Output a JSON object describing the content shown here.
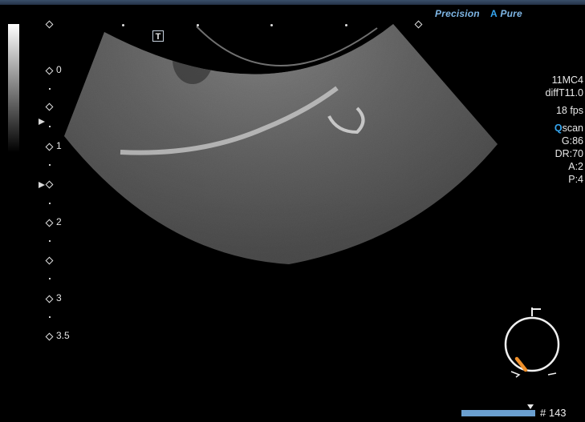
{
  "header": {
    "brand": {
      "left_word": "Precision",
      "accent_letter": "A",
      "right_word": "Pure"
    }
  },
  "depth_scale": {
    "labels": [
      "0",
      "1",
      "2",
      "3",
      "3.5"
    ]
  },
  "marker_t": "T",
  "parameters": {
    "probe": "11MC4",
    "mode": "diffT11.0",
    "frame_rate": "18 fps",
    "qscan_q": "Q",
    "qscan_rest": "scan",
    "gain": "G:86",
    "dynamic_range": "DR:70",
    "param_a": "A:2",
    "param_p": "P:4"
  },
  "cine": {
    "frame_label": "# 143",
    "progress": 0.93
  },
  "colors": {
    "brand": "#7fb7e6",
    "accent": "#35a6f0",
    "cine_bar": "#6a9fd0",
    "probe_marker": "#f0902a"
  },
  "icons": {
    "probe_orientation": "probe-orientation-icon",
    "focus": "focus-marker-icon"
  }
}
